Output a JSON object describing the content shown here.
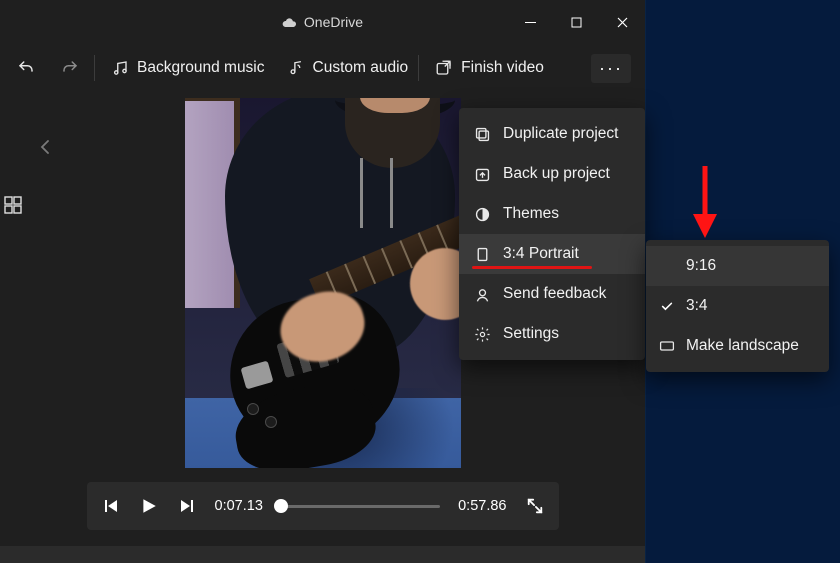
{
  "titlebar": {
    "title": "OneDrive"
  },
  "toolbar": {
    "background_music": "Background music",
    "custom_audio": "Custom audio",
    "finish_video": "Finish video"
  },
  "playback": {
    "current_time": "0:07.13",
    "total_time": "0:57.86"
  },
  "overflow_menu": {
    "duplicate_project": "Duplicate project",
    "back_up_project": "Back up project",
    "themes": "Themes",
    "aspect_current": "3:4 Portrait",
    "send_feedback": "Send feedback",
    "settings": "Settings"
  },
  "aspect_submenu": {
    "opt_916": "9:16",
    "opt_34": "3:4",
    "make_landscape": "Make landscape"
  }
}
